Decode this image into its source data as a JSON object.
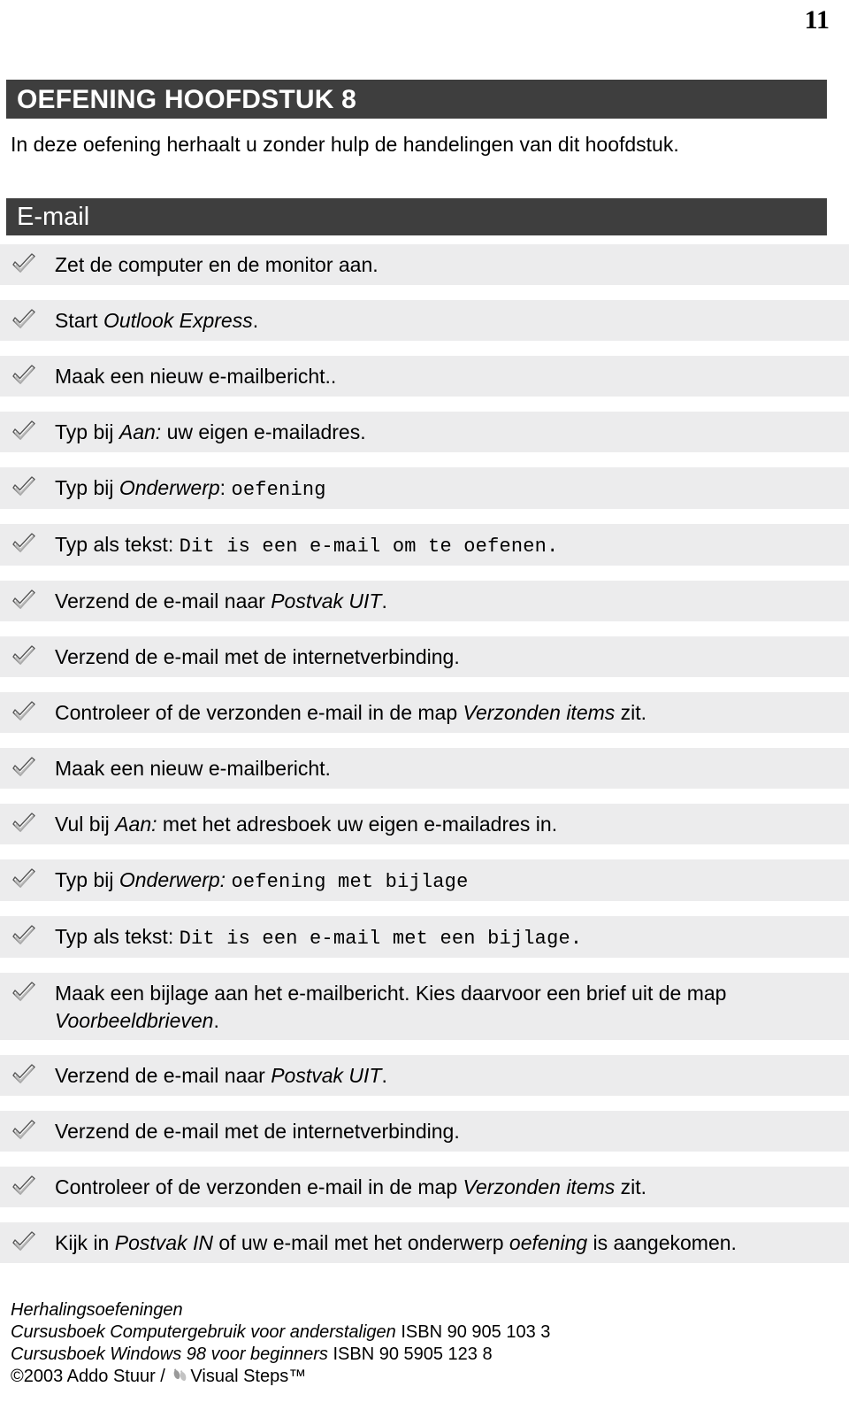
{
  "page": {
    "number": "11"
  },
  "chapter": {
    "title": "OEFENING HOOFDSTUK 8",
    "intro": "In deze oefening herhaalt u zonder hulp de handelingen van dit hoofdstuk."
  },
  "section": {
    "title": "E-mail"
  },
  "checklist": {
    "icon": "checkmark-icon",
    "items": [
      {
        "id": "item-1",
        "parts": [
          {
            "text": "Zet de computer en de monitor aan.",
            "style": "normal"
          }
        ]
      },
      {
        "id": "item-2",
        "parts": [
          {
            "text": "Start ",
            "style": "normal"
          },
          {
            "text": "Outlook Express",
            "style": "italic"
          },
          {
            "text": ".",
            "style": "normal"
          }
        ]
      },
      {
        "id": "item-3",
        "parts": [
          {
            "text": "Maak een nieuw e-mailbericht..",
            "style": "normal"
          }
        ]
      },
      {
        "id": "item-4",
        "parts": [
          {
            "text": "Typ bij ",
            "style": "normal"
          },
          {
            "text": "Aan:",
            "style": "italic"
          },
          {
            "text": " uw eigen e-mailadres.",
            "style": "normal"
          }
        ]
      },
      {
        "id": "item-5",
        "parts": [
          {
            "text": "Typ bij ",
            "style": "normal"
          },
          {
            "text": "Onderwerp",
            "style": "italic"
          },
          {
            "text": ": ",
            "style": "normal"
          },
          {
            "text": "oefening",
            "style": "mono"
          }
        ]
      },
      {
        "id": "item-6",
        "parts": [
          {
            "text": "Typ als tekst: ",
            "style": "normal"
          },
          {
            "text": "Dit is een e-mail om te oefenen.",
            "style": "mono"
          }
        ]
      },
      {
        "id": "item-7",
        "parts": [
          {
            "text": "Verzend de e-mail naar ",
            "style": "normal"
          },
          {
            "text": "Postvak UIT",
            "style": "italic"
          },
          {
            "text": ".",
            "style": "normal"
          }
        ]
      },
      {
        "id": "item-8",
        "parts": [
          {
            "text": "Verzend de e-mail met de internetverbinding.",
            "style": "normal"
          }
        ]
      },
      {
        "id": "item-9",
        "parts": [
          {
            "text": "Controleer of de verzonden e-mail in de map ",
            "style": "normal"
          },
          {
            "text": "Verzonden items",
            "style": "italic"
          },
          {
            "text": " zit.",
            "style": "normal"
          }
        ]
      },
      {
        "id": "item-10",
        "parts": [
          {
            "text": "Maak een nieuw e-mailbericht.",
            "style": "normal"
          }
        ]
      },
      {
        "id": "item-11",
        "parts": [
          {
            "text": "Vul bij ",
            "style": "normal"
          },
          {
            "text": "Aan:",
            "style": "italic"
          },
          {
            "text": " met het adresboek uw eigen e-mailadres in.",
            "style": "normal"
          }
        ]
      },
      {
        "id": "item-12",
        "parts": [
          {
            "text": "Typ bij ",
            "style": "normal"
          },
          {
            "text": "Onderwerp:",
            "style": "italic"
          },
          {
            "text": " ",
            "style": "normal"
          },
          {
            "text": "oefening met bijlage",
            "style": "mono"
          }
        ]
      },
      {
        "id": "item-13",
        "parts": [
          {
            "text": "Typ als tekst: ",
            "style": "normal"
          },
          {
            "text": "Dit is een e-mail met een bijlage.",
            "style": "mono"
          }
        ]
      },
      {
        "id": "item-14",
        "parts": [
          {
            "text": "Maak een bijlage aan het e-mailbericht. Kies daarvoor een brief uit de map ",
            "style": "normal"
          },
          {
            "text": "Voorbeeldbrieven",
            "style": "italic"
          },
          {
            "text": ".",
            "style": "normal"
          }
        ]
      },
      {
        "id": "item-15",
        "parts": [
          {
            "text": "Verzend de e-mail naar ",
            "style": "normal"
          },
          {
            "text": "Postvak UIT",
            "style": "italic"
          },
          {
            "text": ".",
            "style": "normal"
          }
        ]
      },
      {
        "id": "item-16",
        "parts": [
          {
            "text": "Verzend de e-mail met de internetverbinding.",
            "style": "normal"
          }
        ]
      },
      {
        "id": "item-17",
        "parts": [
          {
            "text": "Controleer of de verzonden e-mail in de map ",
            "style": "normal"
          },
          {
            "text": "Verzonden items",
            "style": "italic"
          },
          {
            "text": " zit.",
            "style": "normal"
          }
        ]
      },
      {
        "id": "item-18",
        "parts": [
          {
            "text": "Kijk in ",
            "style": "normal"
          },
          {
            "text": "Postvak IN",
            "style": "italic"
          },
          {
            "text": " of uw e-mail met het onderwerp ",
            "style": "normal"
          },
          {
            "text": "oefening",
            "style": "italic"
          },
          {
            "text": " is aangekomen.",
            "style": "normal"
          }
        ]
      }
    ]
  },
  "footer": {
    "line1": "Herhalingsoefeningen",
    "line2_title": "Cursusboek Computergebruik voor anderstaligen",
    "line2_isbn": "ISBN 90 905 103 3",
    "line3_title": "Cursusboek Windows 98 voor beginners",
    "line3_isbn": "ISBN 90 5905 123 8",
    "line4_copyright": "©2003 Addo Stuur / ",
    "line4_brand": "Visual Steps™",
    "logo": "visual-steps-footprint-logo"
  },
  "colors": {
    "banner_background": "#3e3e3e",
    "banner_text": "#ffffff",
    "row_background": "#ececed",
    "page_background": "#ffffff",
    "text": "#000000"
  }
}
